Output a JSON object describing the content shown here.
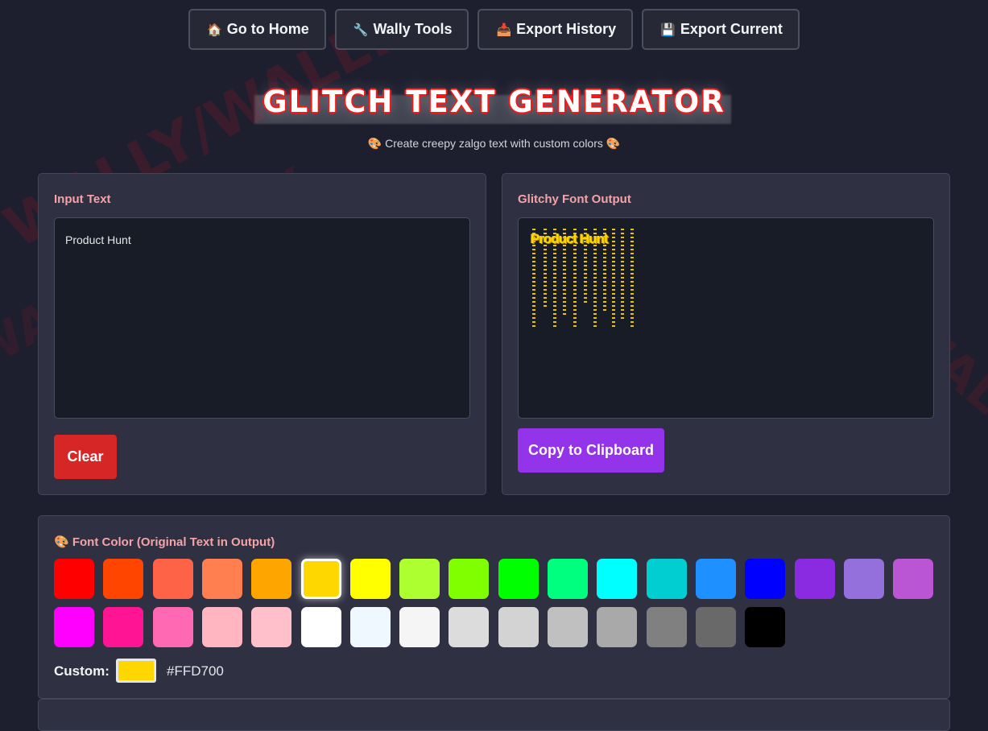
{
  "watermark": {
    "text": "WALLY/WALLY"
  },
  "nav": [
    {
      "icon": "🏠",
      "label": "Go to Home"
    },
    {
      "icon": "🔧",
      "label": "Wally Tools"
    },
    {
      "icon": "📥",
      "label": "Export History"
    },
    {
      "icon": "💾",
      "label": "Export Current"
    }
  ],
  "header": {
    "title": "GLITCH TEXT GENERATOR",
    "subtitle": "🎨 Create creepy zalgo text with custom colors 🎨"
  },
  "input_panel": {
    "label": "Input Text",
    "value": "Product Hunt",
    "clear_label": "Clear"
  },
  "output_panel": {
    "label": "Glitchy Font Output",
    "output_text": "Product Hunt",
    "copy_label": "Copy to Clipboard"
  },
  "color_panel": {
    "label": "🎨 Font Color (Original Text in Output)",
    "swatches_row1": [
      "#FF0000",
      "#FF4500",
      "#FF6347",
      "#FF7F50",
      "#FFA500",
      "#FFD700",
      "#FFFF00",
      "#ADFF2F",
      "#7FFF00",
      "#00FF00",
      "#00FF7F",
      "#00FFFF",
      "#00CED1",
      "#1E90FF",
      "#0000FF",
      "#8A2BE2",
      "#9370DB",
      "#BA55D3"
    ],
    "swatches_row2": [
      "#FF00FF",
      "#FF1493",
      "#FF69B4",
      "#FFB6C1",
      "#FFC0CB",
      "#FFFFFF",
      "#F0F8FF",
      "#F5F5F5",
      "#DCDCDC",
      "#D3D3D3",
      "#C0C0C0",
      "#A9A9A9",
      "#808080",
      "#696969",
      "#000000"
    ],
    "selected": "#FFD700",
    "custom_label": "Custom:",
    "custom_value": "#FFD700"
  },
  "colors": {
    "accent_red": "#D62626",
    "accent_purple": "#9333EA",
    "label_pink": "#F5A3A8"
  }
}
